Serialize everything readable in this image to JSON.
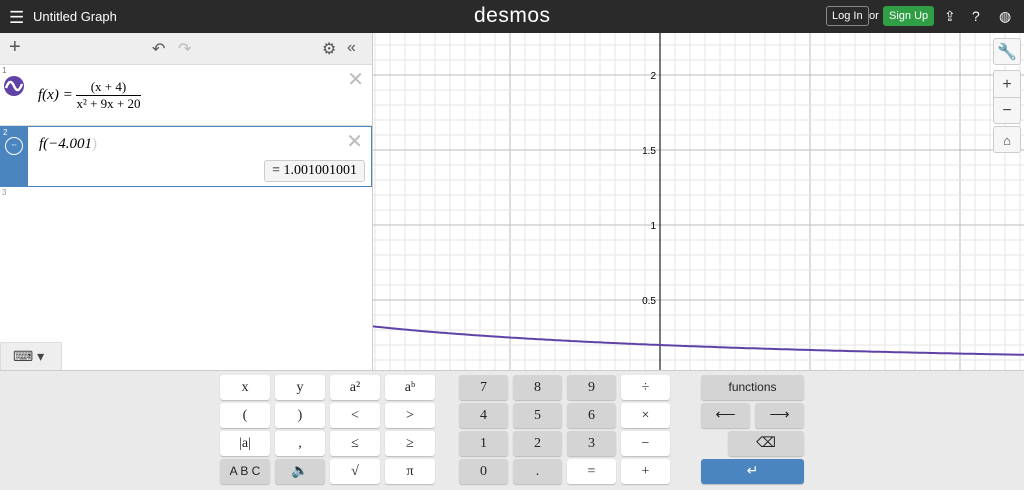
{
  "header": {
    "title": "Untitled Graph",
    "logo": "desmos",
    "login": "Log In",
    "or": "or",
    "signup": "Sign Up"
  },
  "expressions": [
    {
      "num": "1",
      "lhs": "f(x) =",
      "numerator": "(x + 4)",
      "denominator": "x² + 9x + 20",
      "color": "#6042a6"
    },
    {
      "num": "2",
      "text": "f(−4.001",
      "close": ")",
      "result": "= 1.001001001",
      "color": "#4a85c0"
    },
    {
      "num": "3"
    }
  ],
  "graph": {
    "y_labels": [
      "2",
      "1.5",
      "1",
      "0.5"
    ],
    "function": "(x+4)/(x^2+9x+20)"
  },
  "keypad": {
    "left": [
      [
        "x",
        "y",
        "a²",
        "aᵇ"
      ],
      [
        "(",
        ")",
        "<",
        ">"
      ],
      [
        "|a|",
        ",",
        "≤",
        "≥"
      ],
      [
        "A B C",
        "🔈",
        "√",
        "π"
      ]
    ],
    "num": [
      [
        "7",
        "8",
        "9",
        "÷"
      ],
      [
        "4",
        "5",
        "6",
        "×"
      ],
      [
        "1",
        "2",
        "3",
        "−"
      ],
      [
        "0",
        ".",
        "=",
        "+"
      ]
    ],
    "functions": "functions",
    "left_arrow": "⟵",
    "right_arrow": "⟶",
    "backspace": "⌫",
    "enter": "↵"
  }
}
